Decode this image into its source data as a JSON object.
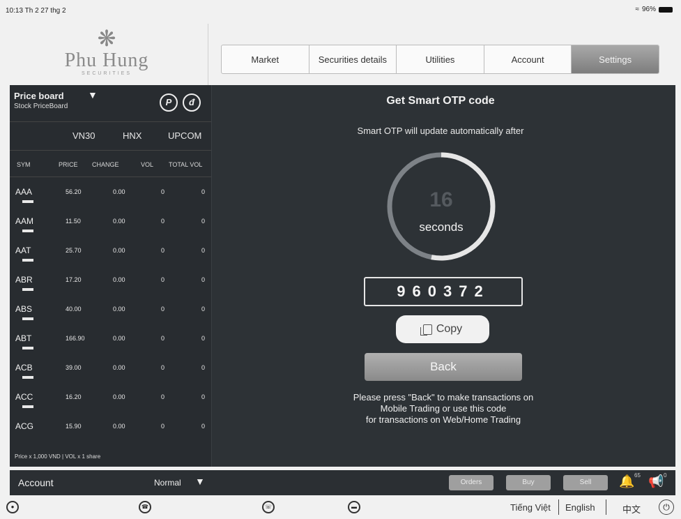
{
  "status": {
    "time": "10:13  Th 2 27 thg 2",
    "battery": "96%"
  },
  "logo": {
    "name": "Phu Hung",
    "sub": "SECURITIES"
  },
  "tabs": [
    {
      "label": "Market"
    },
    {
      "label": "Securities details"
    },
    {
      "label": "Utilities"
    },
    {
      "label": "Account"
    },
    {
      "label": "Settings"
    }
  ],
  "priceboard": {
    "title": "Price board",
    "subtitle": "Stock PriceBoard",
    "icons": {
      "p": "P",
      "d": "đ"
    },
    "exchanges": [
      "VN30",
      "HNX",
      "UPCOM"
    ],
    "columns": [
      "SYM",
      "PRICE",
      "CHANGE",
      "VOL",
      "TOTAL VOL"
    ],
    "rows": [
      {
        "sym": "AAA",
        "price": "56.20",
        "change": "0.00",
        "vol": "0",
        "total": "0"
      },
      {
        "sym": "AAM",
        "price": "11.50",
        "change": "0.00",
        "vol": "0",
        "total": "0"
      },
      {
        "sym": "AAT",
        "price": "25.70",
        "change": "0.00",
        "vol": "0",
        "total": "0"
      },
      {
        "sym": "ABR",
        "price": "17.20",
        "change": "0.00",
        "vol": "0",
        "total": "0"
      },
      {
        "sym": "ABS",
        "price": "40.00",
        "change": "0.00",
        "vol": "0",
        "total": "0"
      },
      {
        "sym": "ABT",
        "price": "166.90",
        "change": "0.00",
        "vol": "0",
        "total": "0"
      },
      {
        "sym": "ACB",
        "price": "39.00",
        "change": "0.00",
        "vol": "0",
        "total": "0"
      },
      {
        "sym": "ACC",
        "price": "16.20",
        "change": "0.00",
        "vol": "0",
        "total": "0"
      },
      {
        "sym": "ACG",
        "price": "15.90",
        "change": "0.00",
        "vol": "0",
        "total": "0"
      }
    ],
    "footnote": "Price x 1,000 VND | VOL x 1 share"
  },
  "otp": {
    "title": "Get Smart OTP code",
    "subtitle": "Smart OTP will update automatically after",
    "countdown": "16",
    "countdown_label": "seconds",
    "countdown_fraction": 0.53,
    "code": "960372",
    "copy_label": "Copy",
    "back_label": "Back",
    "note_line1": "Please press \"Back\" to make transactions on",
    "note_line2": "Mobile Trading or use this code",
    "note_line3": "for transactions on Web/Home Trading"
  },
  "bottom": {
    "account_label": "Account",
    "mode": "Normal",
    "orders_label": "Orders",
    "buy_label": "Buy",
    "sell_label": "Sell",
    "bell_count": "65",
    "mega_count": "0"
  },
  "languages": [
    "Tiếng Việt",
    "English",
    "中文"
  ]
}
